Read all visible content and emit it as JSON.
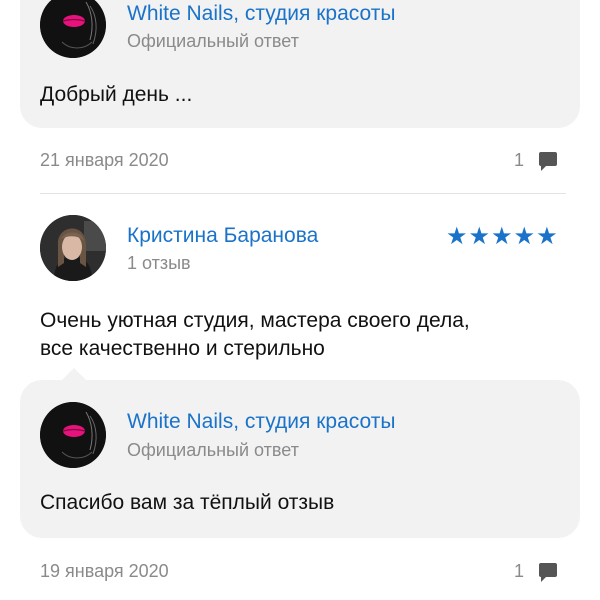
{
  "review1": {
    "reply": {
      "author": "White Nails, студия красоты",
      "role": "Официальный ответ",
      "text": "Добрый день ..."
    },
    "date": "21 января 2020",
    "comments_count": "1"
  },
  "review2": {
    "author": "Кристина Баранова",
    "author_meta": "1 отзыв",
    "rating": 5,
    "rating_stars": "★★★★★",
    "text_line1": "Очень уютная студия, мастера своего дела,",
    "text_line2": "все качественно и стерильно",
    "reply": {
      "author": "White Nails, студия красоты",
      "role": "Официальный ответ",
      "text": "Спасибо вам за тёплый отзыв"
    },
    "date": "19 января 2020",
    "comments_count": "1"
  },
  "colors": {
    "accent": "#1a73c9",
    "muted": "#8a8a8a",
    "bubble_bg": "#f2f2f2",
    "logo_lips": "#e8127c"
  }
}
